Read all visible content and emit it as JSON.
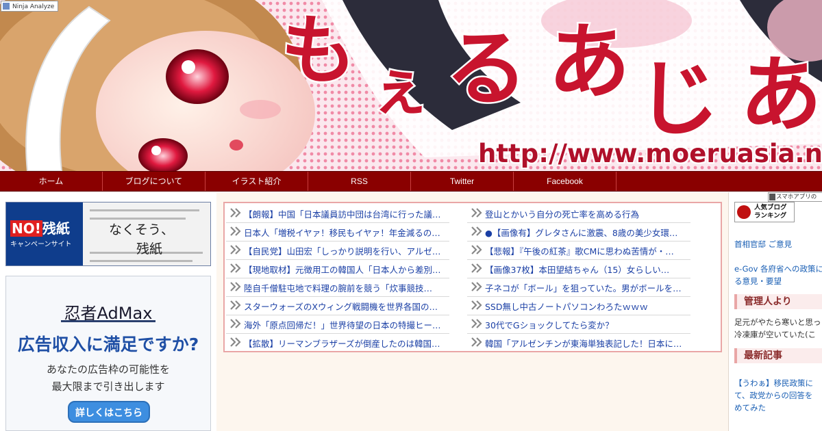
{
  "header": {
    "ninja_label": "Ninja Analyze",
    "site_url": "http://www.moeruasia.net",
    "colors": {
      "title_red": "#c8142e",
      "banner_bg": "#f7e3ea"
    }
  },
  "nav": {
    "items": [
      {
        "label": "ホーム"
      },
      {
        "label": "ブログについて"
      },
      {
        "label": "イラスト紹介"
      },
      {
        "label": "RSS"
      },
      {
        "label": "Twitter"
      },
      {
        "label": "Facebook"
      }
    ]
  },
  "left": {
    "ad_paper": {
      "title_no": "NO!",
      "title_rest": "残紙",
      "subtitle": "キャンペーンサイト",
      "slogan_line1": "なくそう、",
      "slogan_line2": "残紙"
    },
    "ad_admax": {
      "logo": "忍者AdMax",
      "headline": "広告収入に満足ですか?",
      "body_line1": "あなたの広告枠の可能性を",
      "body_line2": "最大限まで引き出します",
      "button": "詳しくはこちら"
    }
  },
  "news": {
    "left": [
      "【朗報】中国「日本議員訪中団は台湾に行った議…",
      "日本人「増税イヤァ！移民もイヤァ！年金減るの…",
      "【自民党】山田宏「しっかり説明を行い、アルゼ…",
      "【現地取材】元徴用工の韓国人「日本人から差別…",
      "陸自千僧駐屯地で料理の腕前を競う「炊事競技…",
      "スターウォーズのXウィング戦闘機を世界各国の…",
      "海外「原点回帰だ！」世界待望の日本の特撮ヒー…",
      "【拡散】リーマンブラザーズが倒産したのは韓国…"
    ],
    "right": [
      "登山とかいう自分の死亡率を高める行為",
      "●【画像有】グレタさんに激震、8歳の美少女環…",
      "【悲報】『午後の紅茶』歌CMに思わぬ苦情が・…",
      "【画像37枚】本田望結ちゃん（15）女らしい…",
      "子ネコが「ボール」を狙っていた。男がボールを…",
      "SSD無し中古ノートパソコンわろたｗｗｗ",
      "30代でGショックしてたら変か？",
      "韓国「アルゼンチンが東海単独表記した！日本に…"
    ]
  },
  "right": {
    "app_bar": "スマホアプリの",
    "ranking_line1": "人気ブログ",
    "ranking_line2": "ランキング",
    "link1": "首相官邸 ご意見",
    "link2_line1": "e-Gov 各府省への政策に",
    "link2_line2": "る意見・要望",
    "heading_admin": "管理人より",
    "admin_line1": "足元がやたら寒いと思っ",
    "admin_line2": "冷凍庫が空いていた(こ",
    "heading_latest": "最新記事",
    "latest_line1": "【うわぁ】移民政策に",
    "latest_line2": "て、政党からの回答を",
    "latest_line3": "めてみた"
  }
}
